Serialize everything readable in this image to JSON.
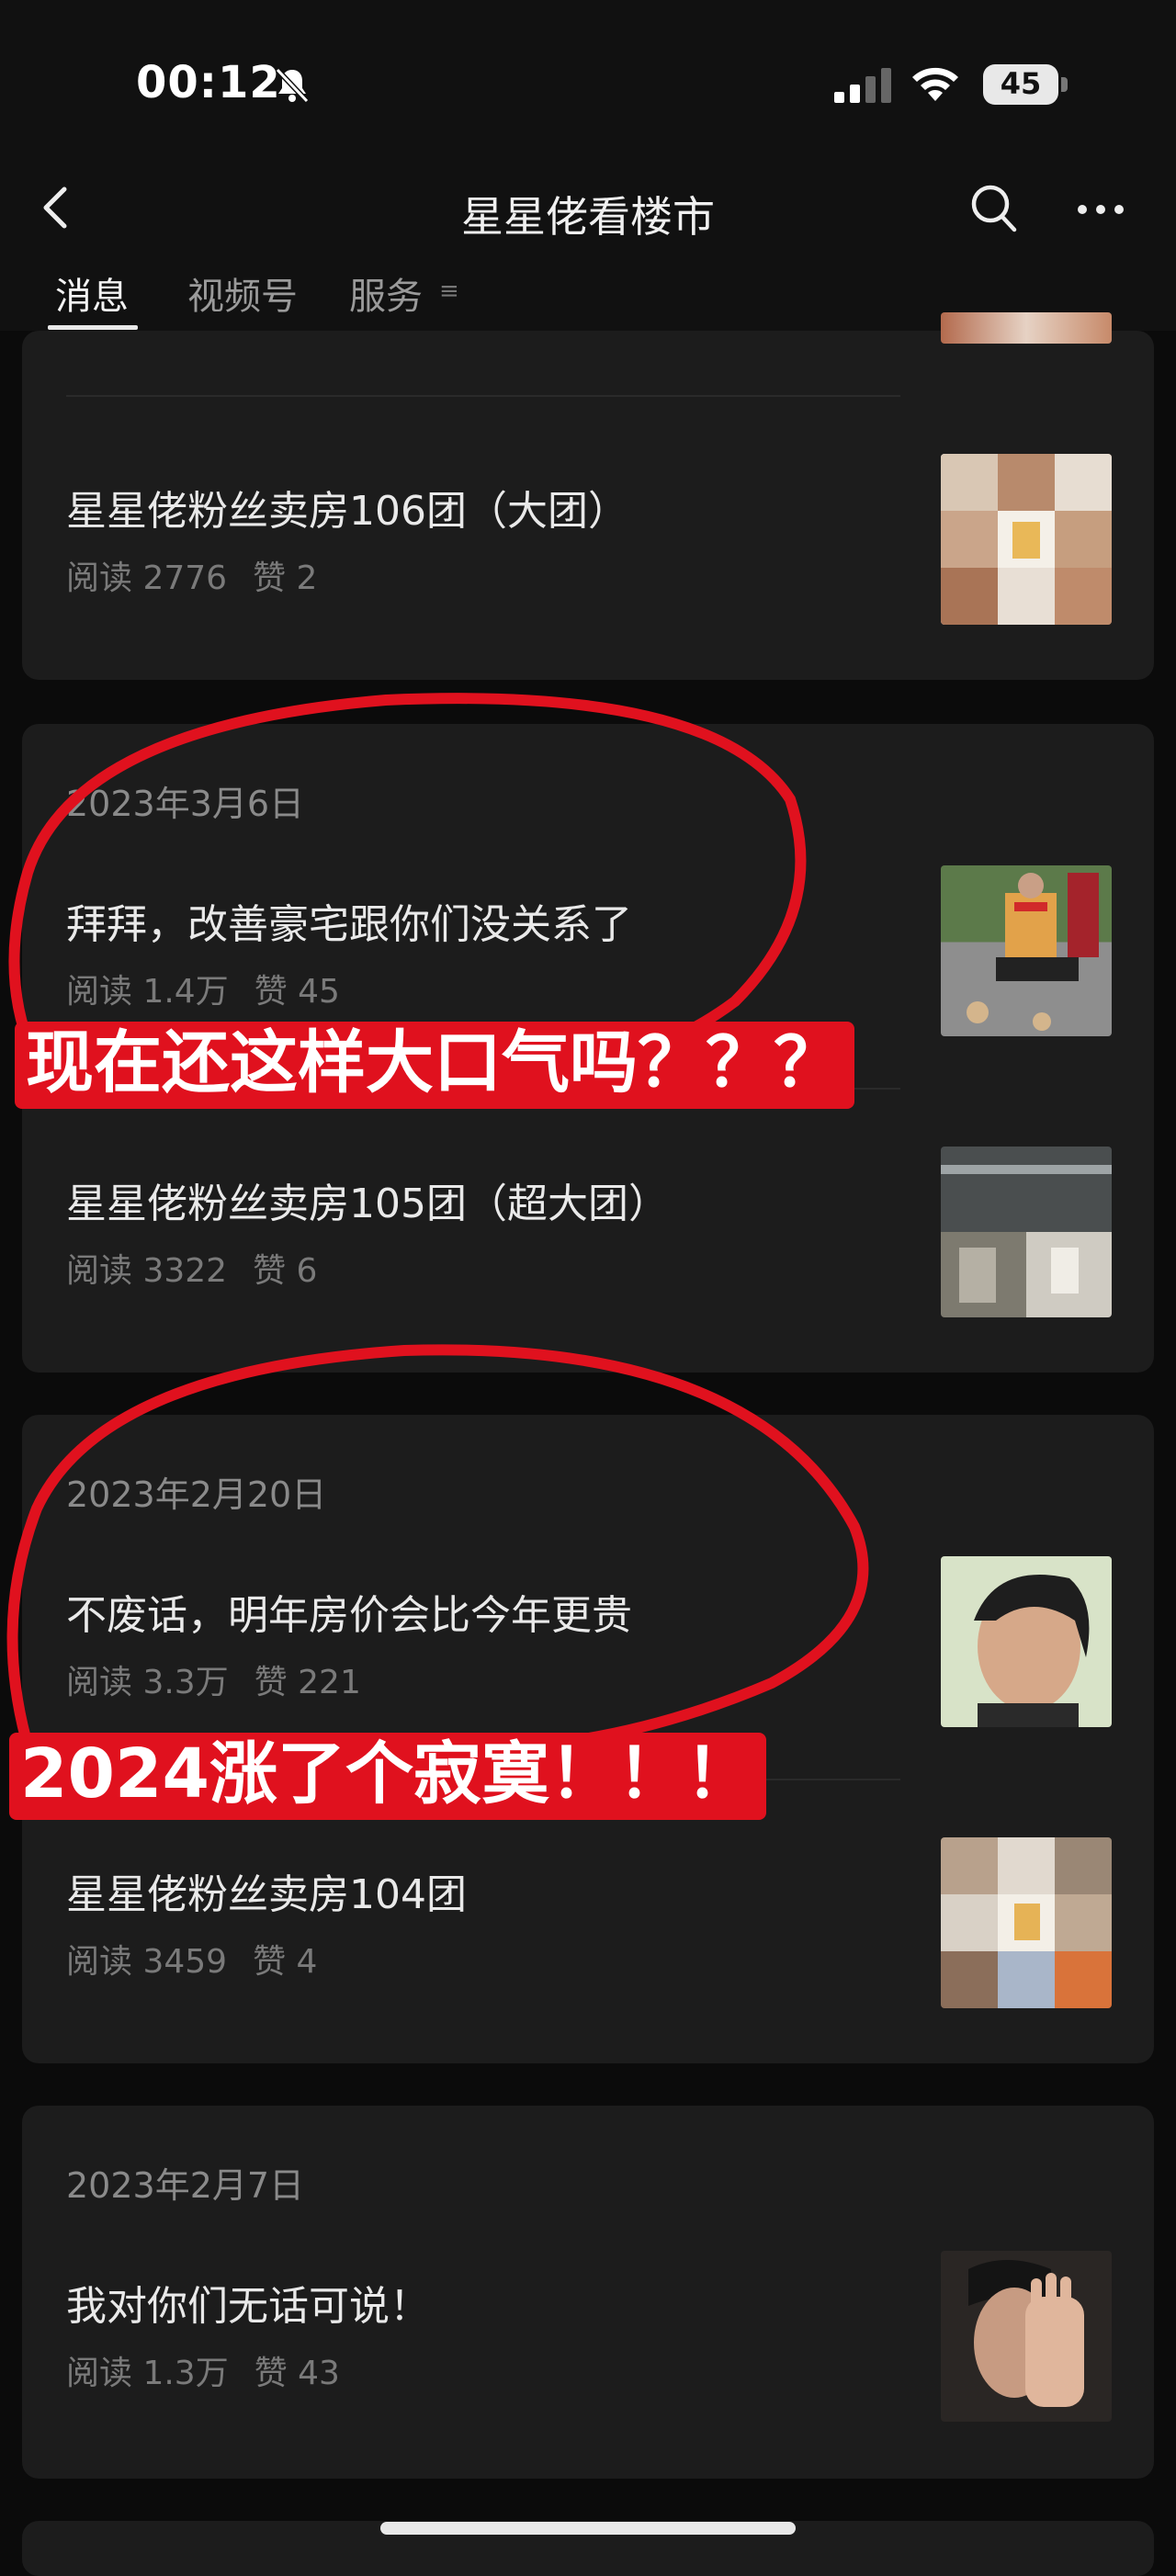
{
  "status_bar": {
    "time": "00:12",
    "battery": "45"
  },
  "nav": {
    "title": "星星佬看楼市"
  },
  "tabs": [
    {
      "label": "消息"
    },
    {
      "label": "视频号"
    },
    {
      "label": "服务"
    }
  ],
  "groups": [
    {
      "date": "",
      "articles": [
        {
          "title": "星星佬粉丝卖房106团（大团）",
          "reads": "阅读 2776",
          "likes": "赞 2"
        }
      ]
    },
    {
      "date": "2023年3月6日",
      "articles": [
        {
          "title": "拜拜，改善豪宅跟你们没关系了",
          "reads": "阅读 1.4万",
          "likes": "赞 45"
        },
        {
          "title": "星星佬粉丝卖房105团（超大团）",
          "reads": "阅读 3322",
          "likes": "赞 6"
        }
      ]
    },
    {
      "date": "2023年2月20日",
      "articles": [
        {
          "title": "不废话，明年房价会比今年更贵",
          "reads": "阅读 3.3万",
          "likes": "赞 221"
        },
        {
          "title": "星星佬粉丝卖房104团",
          "reads": "阅读 3459",
          "likes": "赞 4"
        }
      ]
    },
    {
      "date": "2023年2月7日",
      "articles": [
        {
          "title": "我对你们无话可说！",
          "reads": "阅读 1.3万",
          "likes": "赞 43"
        }
      ]
    }
  ],
  "annotations": [
    {
      "text": "现在还这样大口气吗？？？"
    },
    {
      "text": "2024涨了个寂寞！！！"
    }
  ],
  "colors": {
    "annotation_red": "#e0111e",
    "card_bg": "#1c1c1c",
    "page_bg": "#0b0b0b"
  }
}
